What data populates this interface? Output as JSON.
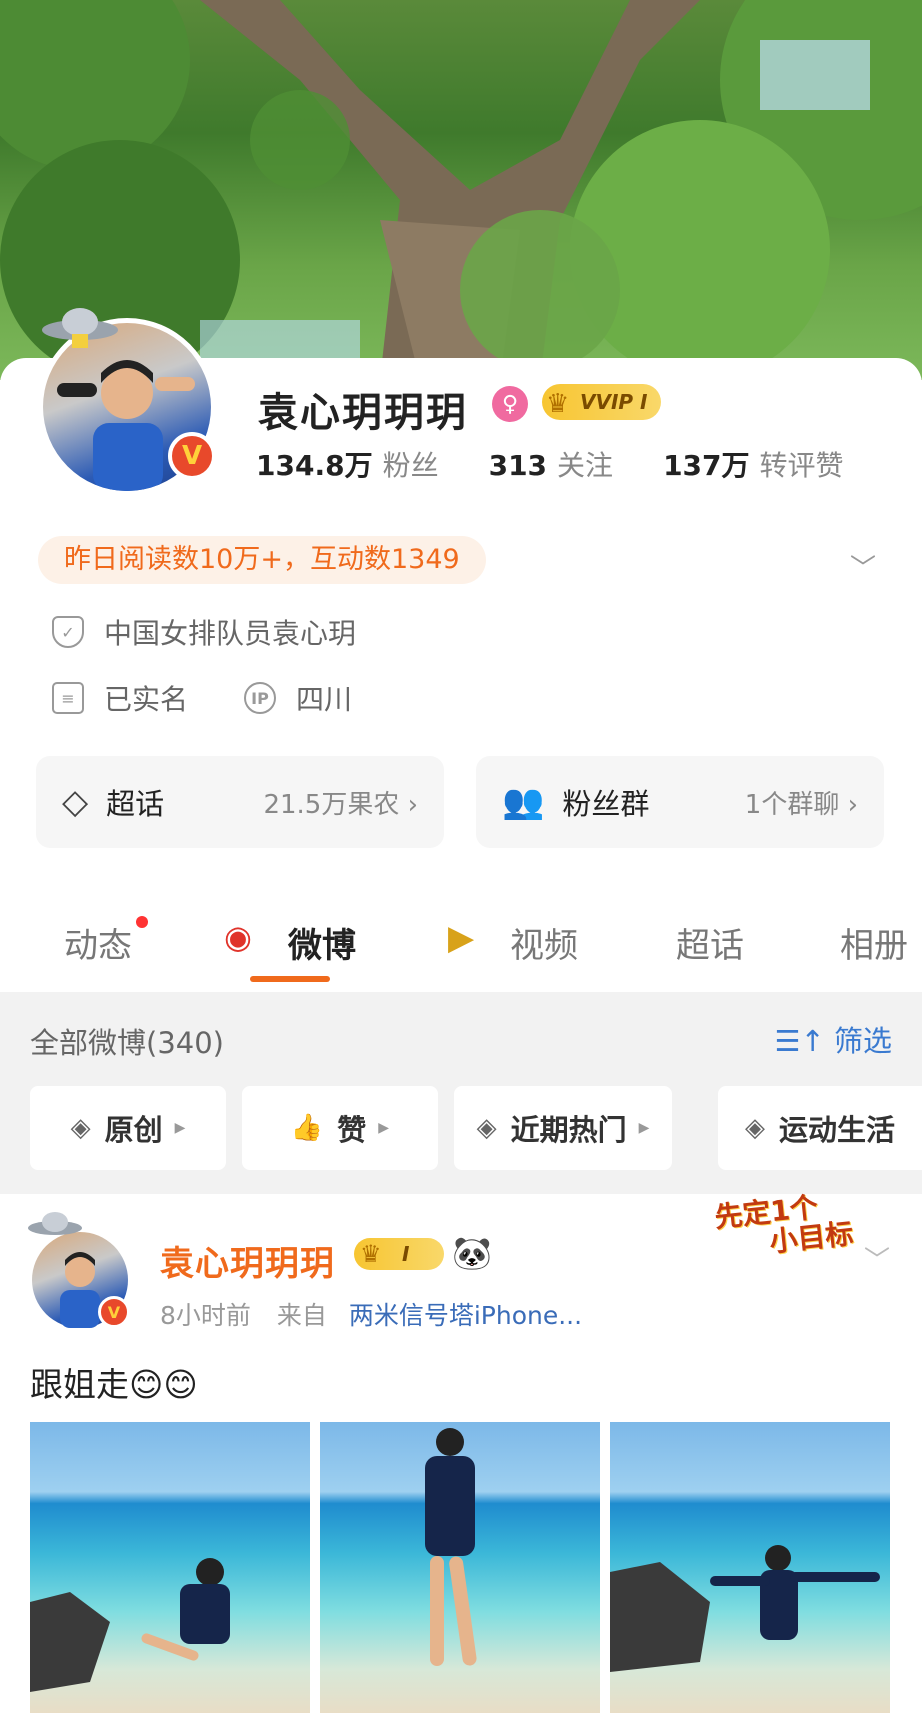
{
  "profile": {
    "name": "袁心玥玥玥",
    "vip_badge": "VVIP I",
    "gender_icon": "female-icon",
    "stats": [
      {
        "value": "134.8万",
        "label": "粉丝"
      },
      {
        "value": "313",
        "label": "关注"
      },
      {
        "value": "137万",
        "label": "转评赞"
      }
    ],
    "read_pill": "昨日阅读数10万+，互动数1349",
    "verification": "中国女排队员袁心玥",
    "real_name": "已实名",
    "ip_icon_text": "IP",
    "ip_location": "四川",
    "verified_badge": "V"
  },
  "boxes": {
    "super_topic": {
      "label": "超话",
      "right": "21.5万果农 ›"
    },
    "fan_group": {
      "label": "粉丝群",
      "right": "1个群聊 ›"
    }
  },
  "tabs": [
    {
      "label": "动态"
    },
    {
      "label": "微博"
    },
    {
      "label": "视频"
    },
    {
      "label": "超话"
    },
    {
      "label": "相册"
    }
  ],
  "filter": {
    "total": "全部微博(340)",
    "screen_label": "筛选",
    "chips": [
      "原创",
      "赞",
      "近期热门",
      "运动生活"
    ]
  },
  "post": {
    "author": "袁心玥玥玥",
    "level_badge": "I",
    "panda": "🐼",
    "sticker_line1": "先定1个",
    "sticker_line2": "小目标",
    "time": "8小时前",
    "from": "来自",
    "source": "两米信号塔iPhone...",
    "text": "跟姐走😊😊"
  },
  "colors": {
    "accent_orange": "#f06a1c",
    "link_blue": "#3a7ad0",
    "vip_gold": "#f7c531"
  }
}
